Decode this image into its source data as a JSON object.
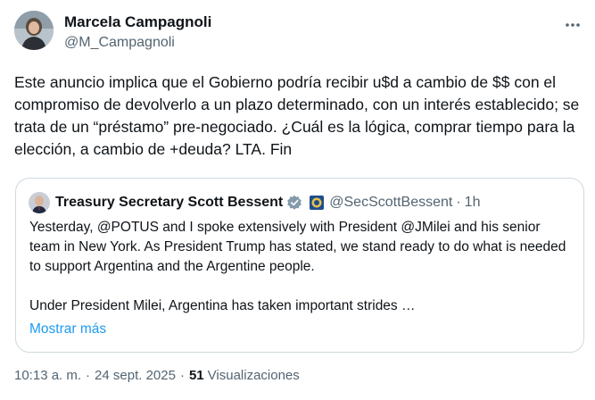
{
  "author": {
    "name": "Marcela Campagnoli",
    "handle": "@M_Campagnoli"
  },
  "tweet": {
    "text": "Este anuncio implica que el Gobierno podría recibir u$d a cambio de $$ con el compromiso de devolverlo a un plazo determinado, con un interés establecido; se trata de un “préstamo” pre-negociado. ¿Cuál es la lógica, comprar tiempo para la elección, a cambio de +deuda? LTA. Fin"
  },
  "quoted": {
    "name": "Treasury Secretary Scott Bessent",
    "handle": "@SecScottBessent",
    "separator": "·",
    "time": "1h",
    "paragraph1": "Yesterday, @POTUS and I spoke extensively with President @JMilei and his senior team in New York.  As President Trump has stated, we stand ready to do what is needed to support Argentina and the Argentine people.",
    "paragraph2": "Under President Milei, Argentina has taken important strides …",
    "show_more": "Mostrar más"
  },
  "meta": {
    "time": "10:13 a. m.",
    "date": "24 sept. 2025",
    "separator": "·",
    "views_count": "51",
    "views_label": "Visualizaciones"
  },
  "icons": {
    "more": "more-horizontal-icon",
    "verified": "verified-badge-icon",
    "seal": "government-seal-icon"
  },
  "colors": {
    "accent": "#1d9bf0",
    "secondary_text": "#536471",
    "border": "#cfd9de",
    "verified_gray": "#829aab"
  }
}
